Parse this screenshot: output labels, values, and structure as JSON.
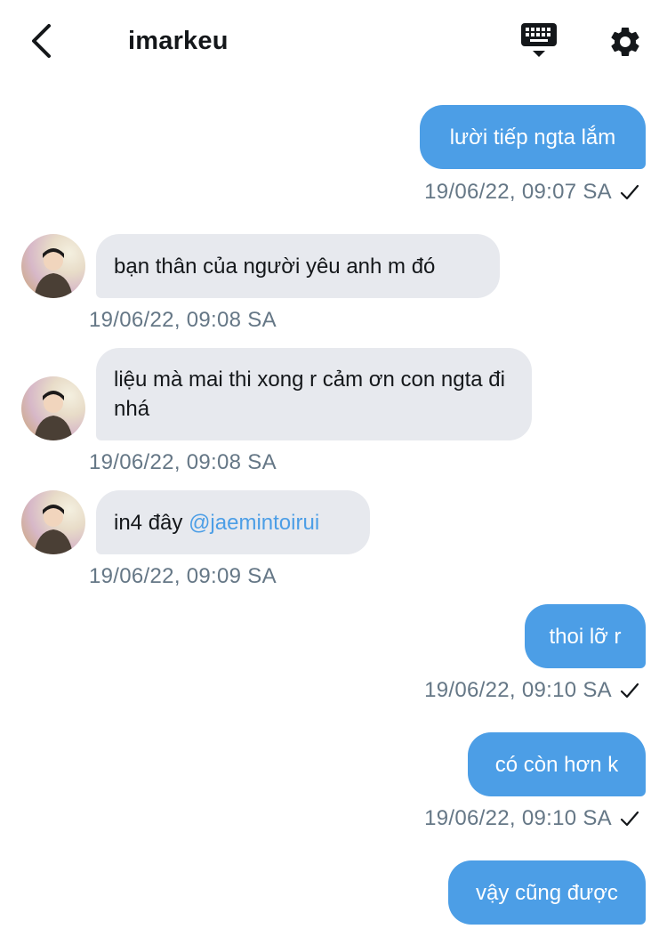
{
  "header": {
    "title": "imarkeu"
  },
  "messages": [
    {
      "direction": "out",
      "text": "lười tiếp ngta lắm",
      "time": "19/06/22, 09:07 SA",
      "read": true
    },
    {
      "direction": "in",
      "text": "bạn thân của người yêu anh m đó",
      "time": "19/06/22, 09:08 SA"
    },
    {
      "direction": "in",
      "text": "liệu mà mai thi xong r cảm ơn con ngta đi nhá",
      "time": "19/06/22, 09:08 SA"
    },
    {
      "direction": "in",
      "text_prefix": "in4 đây ",
      "mention": "@jaemintoirui",
      "time": "19/06/22, 09:09 SA"
    },
    {
      "direction": "out",
      "text": "thoi lỡ r",
      "time": "19/06/22, 09:10 SA",
      "read": true
    },
    {
      "direction": "out",
      "text": "có còn hơn k",
      "time": "19/06/22, 09:10 SA",
      "read": true
    },
    {
      "direction": "out",
      "text": "vậy cũng được"
    }
  ],
  "icons": {
    "back": "chevron-left-icon",
    "keyboard": "keyboard-icon",
    "settings": "gear-icon",
    "read_receipt": "checkmark-icon"
  },
  "colors": {
    "outgoing_bubble": "#4c9ee6",
    "incoming_bubble": "#e7e9ee",
    "timestamp": "#657786",
    "mention": "#4c9ee6"
  }
}
